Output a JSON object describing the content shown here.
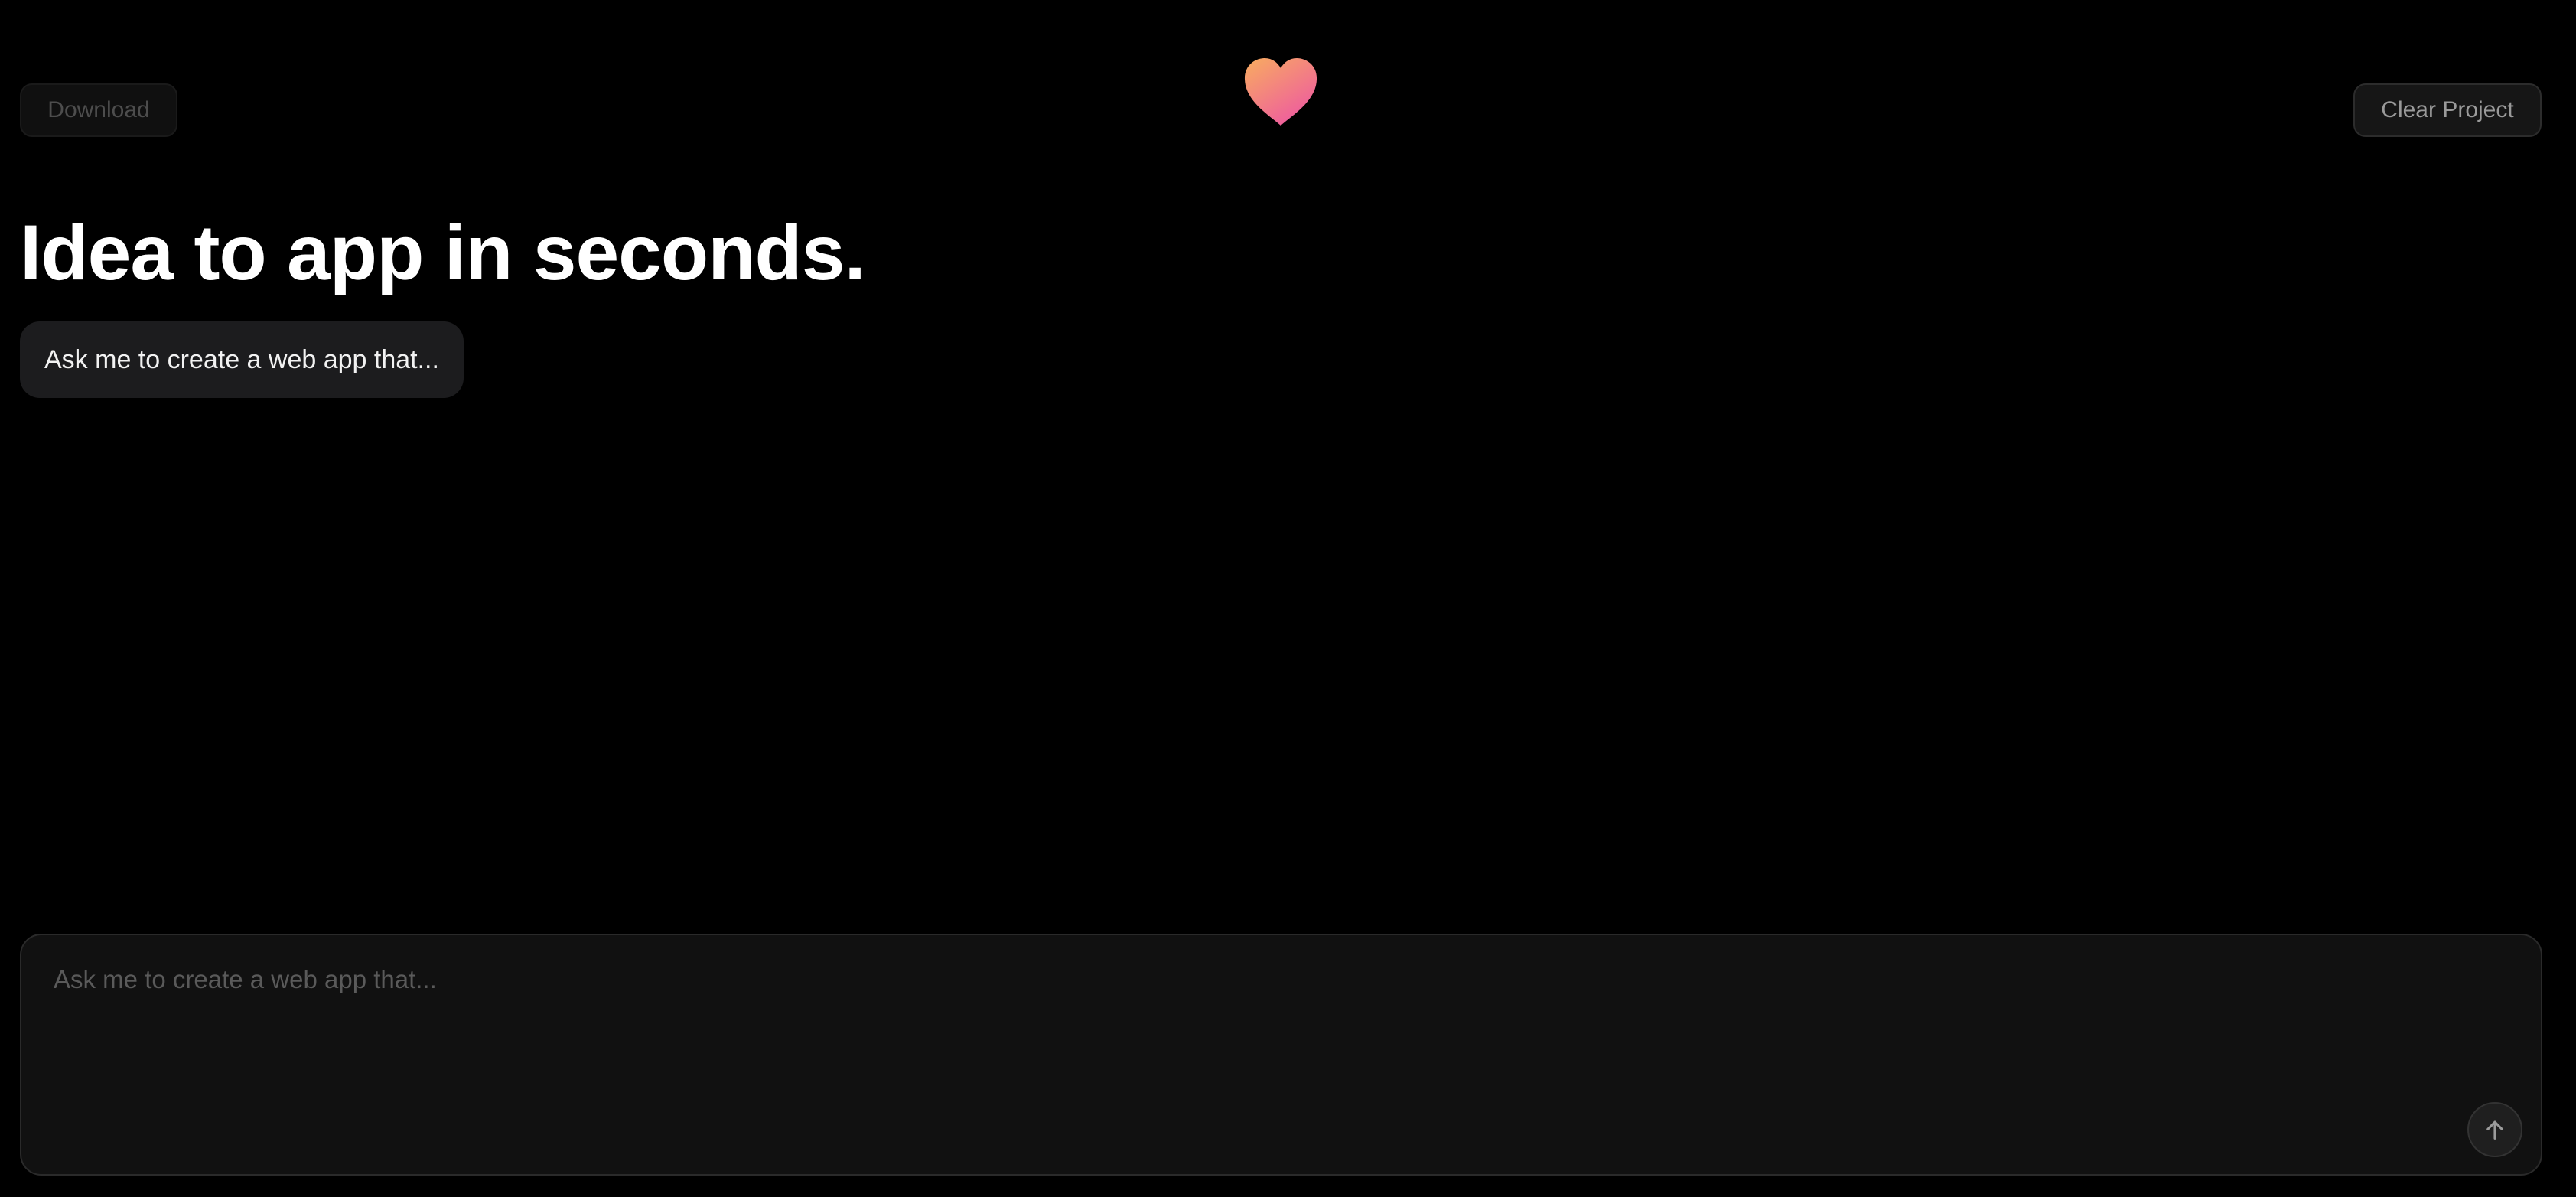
{
  "header": {
    "download_label": "Download",
    "clear_label": "Clear Project",
    "logo_icon": "heart-icon",
    "logo_gradient": [
      "#f7a35c",
      "#f0609a"
    ]
  },
  "hero": {
    "headline": "Idea to app in seconds.",
    "suggestion": "Ask me to create a web app that..."
  },
  "composer": {
    "placeholder": "Ask me to create a web app that...",
    "value": "",
    "send_icon": "arrow-up-icon"
  }
}
